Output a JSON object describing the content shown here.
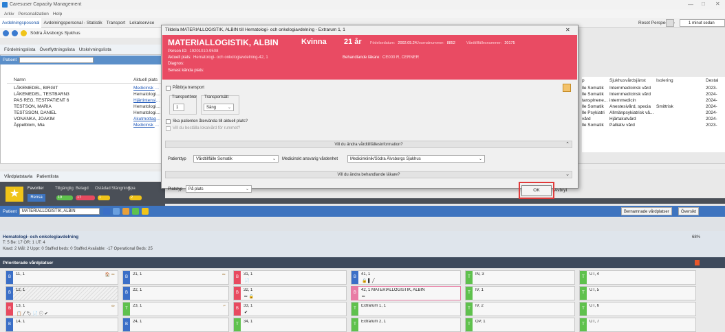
{
  "window": {
    "title": "Caresuser Capacity Management",
    "minimize": "—",
    "maximize": "□",
    "close": "✕"
  },
  "menu": [
    "Arkiv",
    "Personalization",
    "Help"
  ],
  "main_tabs": [
    "Avdelningsposonal",
    "Avdelningspersonal - Statistik",
    "Transport",
    "Lokalservice"
  ],
  "reset_perspective": "Reset Perspective",
  "perspective_1min": "1 minut sedan",
  "toolbar_text": "Södra Älvsborgs Sjukhus",
  "upper_tabs": [
    "Fördelningslista",
    "Överflyttningslista",
    "Utskrivningslista"
  ],
  "patient_label": "Patient",
  "grid_headers": {
    "name": "Namn",
    "place": "Aktuell plats"
  },
  "patients": [
    {
      "name": "LÄKEMEDEL, BIRGIT",
      "place": "Medicinsk akut",
      "link": true
    },
    {
      "name": "LÄKEMEDEL, TESTBARN3",
      "place": "Hematologi- oc",
      "link": false
    },
    {
      "name": "PAS REG, TESTPATIENT 6",
      "place": "Hjärtintensivvår",
      "link": true
    },
    {
      "name": "TESTSON, MARIA",
      "place": "Hematologi- oc",
      "link": false
    },
    {
      "name": "TESTSSON, DANIEL",
      "place": "Hematologi- oc",
      "link": false
    },
    {
      "name": "VONANKA, JOAKIM",
      "place": "Akutmottagning",
      "link": true
    },
    {
      "name": "Äppelblom, Mia",
      "place": "Medicinsk akut",
      "link": true
    }
  ],
  "right_headers": {
    "sp": "p",
    "care": "Sjukhusvårdsjänst",
    "iso": "Isolering",
    "dest": "Destal"
  },
  "right_rows": [
    {
      "sp": "lle Somatik",
      "care": "Internmedicinsk vård",
      "iso": "",
      "dest": "2023-"
    },
    {
      "sp": "lle Somatik",
      "care": "Internmedicinsk vård",
      "iso": "",
      "dest": "2024-"
    },
    {
      "sp": "tansplnene...",
      "care": "internmedicin",
      "iso": "",
      "dest": "2024-"
    },
    {
      "sp": "lle Somatik",
      "care": "Anestesivård, specia",
      "iso": "Smittrisk",
      "dest": "2024-"
    },
    {
      "sp": "lle Psykiatri",
      "care": "Allmänpsykiatrisk vå...",
      "iso": "",
      "dest": "2024-"
    },
    {
      "sp": "vård",
      "care": "Hjärtakutvård",
      "iso": "",
      "dest": "2024-"
    },
    {
      "sp": "lle Somatik",
      "care": "Palliativ vård",
      "iso": "",
      "dest": "2023-"
    }
  ],
  "lower_tabs": [
    "Vårdplatstavla",
    "Patientlista"
  ],
  "filters": {
    "favoriter": "Favoriter",
    "rensa": "Rensa",
    "tabs": [
      "Tillgänglig",
      "Belagd",
      "Ostädad",
      "Stängning",
      "Spa"
    ],
    "counts": [
      {
        "label": "19",
        "color": "#5fc14d"
      },
      {
        "label": "17",
        "color": "#e84a5f"
      },
      {
        "label": "1",
        "color": "#f0c419"
      },
      {
        "label": "2",
        "color": "#f0c419"
      }
    ]
  },
  "patient2": {
    "label": "Patient",
    "value": "MATERIALLOGISTIK, ALBIN"
  },
  "toolbar_right": {
    "bernamade": "Bernamnade vårdplatser",
    "oversikt": "Översikt"
  },
  "dept": {
    "name": "Hematologi- och onkologiavdelning",
    "stats1": "T: 5 Be: 17 OR: 1 UT: 4",
    "stats2": "Kavd: 2 Mål: 2 Uppr: 0 Staffed beds: 0 Staffed Available: -17 Operational Beds: 25",
    "pct": "68%"
  },
  "prio_label": "Prioriterade vårdplatser",
  "beds": [
    {
      "label": "11, 1",
      "tag": "B",
      "color": "blue",
      "col": 0,
      "row": 0,
      "mark": "",
      "ico": "🏠 ✏"
    },
    {
      "label": "12, 1",
      "tag": "B",
      "color": "blue",
      "col": 0,
      "row": 1,
      "mark": "",
      "ico": "",
      "hatched": true
    },
    {
      "label": "13, 1",
      "tag": "B",
      "color": "red",
      "col": 0,
      "row": 2,
      "mark": "📋 ╱ 🏷 📄 ⓘ ✔",
      "ico": "✏"
    },
    {
      "label": "14, 1",
      "tag": "B",
      "color": "blue",
      "col": 0,
      "row": 3,
      "mark": "",
      "ico": ""
    },
    {
      "label": "21, 1",
      "tag": "B",
      "color": "blue",
      "col": 1,
      "row": 0,
      "mark": "",
      "ico": "✏"
    },
    {
      "label": "22, 1",
      "tag": "B",
      "color": "blue",
      "col": 1,
      "row": 1,
      "mark": "",
      "ico": ""
    },
    {
      "label": "23, 1",
      "tag": "T",
      "color": "green",
      "col": 1,
      "row": 2,
      "mark": "",
      "ico": "⌐"
    },
    {
      "label": "24, 1",
      "tag": "B",
      "color": "blue",
      "col": 1,
      "row": 3,
      "mark": "",
      "ico": ""
    },
    {
      "label": "31, 1",
      "tag": "B",
      "color": "red",
      "col": 2,
      "row": 0,
      "mark": "📄",
      "ico": ""
    },
    {
      "label": "32, 1",
      "tag": "B",
      "color": "red",
      "col": 2,
      "row": 1,
      "mark": "✏ 🔒",
      "ico": ""
    },
    {
      "label": "33, 1",
      "tag": "B",
      "color": "red",
      "col": 2,
      "row": 2,
      "mark": "✔",
      "ico": ""
    },
    {
      "label": "34, 1",
      "tag": "T",
      "color": "green",
      "col": 2,
      "row": 3,
      "mark": "",
      "ico": ""
    },
    {
      "label": "41, 1",
      "tag": "B",
      "color": "blue",
      "col": 3,
      "row": 0,
      "mark": "🔒 ▌ ╱",
      "ico": ""
    },
    {
      "label": "42, 1   MATERIALLOGISTIK, ALBIN",
      "tag": "B",
      "color": "pink",
      "col": 3,
      "row": 1,
      "mark": "✏",
      "ico": ""
    },
    {
      "label": "Extrarum 1, 1",
      "tag": "T",
      "color": "green",
      "col": 3,
      "row": 2,
      "mark": "",
      "ico": ""
    },
    {
      "label": "Extrarum 2, 1",
      "tag": "T",
      "color": "green",
      "col": 3,
      "row": 3,
      "mark": "",
      "ico": ""
    },
    {
      "label": "IN, 3",
      "tag": "T",
      "color": "green",
      "col": 4,
      "row": 0,
      "mark": "",
      "ico": ""
    },
    {
      "label": "IV, 1",
      "tag": "T",
      "color": "green",
      "col": 4,
      "row": 1,
      "mark": "",
      "ico": ""
    },
    {
      "label": "IV, 2",
      "tag": "T",
      "color": "green",
      "col": 4,
      "row": 2,
      "mark": "",
      "ico": ""
    },
    {
      "label": "OP, 1",
      "tag": "T",
      "color": "green",
      "col": 4,
      "row": 3,
      "mark": "",
      "ico": ""
    },
    {
      "label": "UT, 4",
      "tag": "T",
      "color": "green",
      "col": 5,
      "row": 0,
      "mark": "",
      "ico": ""
    },
    {
      "label": "UT, 5",
      "tag": "T",
      "color": "green",
      "col": 5,
      "row": 1,
      "mark": "",
      "ico": ""
    },
    {
      "label": "UT, 6",
      "tag": "T",
      "color": "green",
      "col": 5,
      "row": 2,
      "mark": "",
      "ico": ""
    },
    {
      "label": "UT, 7",
      "tag": "T",
      "color": "green",
      "col": 5,
      "row": 3,
      "mark": "",
      "ico": ""
    }
  ],
  "modal": {
    "title": "Tilldela MATERIALLOGISTIK, ALBIN till Hematologi- och onkologiavdelning - Extrarum 1, 1",
    "close": "✕",
    "name": "MATERIALLOGISTIK, ALBIN",
    "gender": "Kvinna",
    "age": "21 år",
    "meta": [
      {
        "k": "Födelsedatum:",
        "v": "2002.05.24"
      },
      {
        "k": "Journalnummer:",
        "v": "8852"
      },
      {
        "k": "Vårdtillfällesnummer:",
        "v": "20175"
      }
    ],
    "person_id": {
      "k": "Person ID:",
      "v": "19201010-9508"
    },
    "aktuell": {
      "k": "Aktuell plats:",
      "v": "Hematologi- och onkologiavdelning-42, 1"
    },
    "behandlande": {
      "k": "Behandlande läkare:",
      "v": "CE000 R, CERNER"
    },
    "diagnos": {
      "k": "Diagnos:",
      "v": ""
    },
    "senast": {
      "k": "Senast kända plats:",
      "v": ""
    },
    "paborja": "Påbörja transport",
    "transportorer": "Transportörer",
    "transportsatt": "Transportsätt",
    "transportorer_val": "1",
    "transportsatt_val": "Säng",
    "aterkomma": "Ska patienten återvända till aktuell plats?",
    "bestalla": "Vill du beställa lokalvård för rummet?",
    "sec1": "Vill du ändra vårdtillfällesinformation?",
    "patienttyp_label": "Patienttyp",
    "patienttyp_val": "Vårdtillfälle Somatik",
    "ansvarig_label": "Medicinskt ansvarig vårdenhet",
    "ansvarig_val": "Medicinklinik/Södra Älvsborgs Sjukhus",
    "sec2": "Vill du ändra behandlande läkare?",
    "platstyp_label": "Platstyp",
    "platstyp_val": "På plats",
    "ok": "OK",
    "avbryt": "Avbryt"
  }
}
